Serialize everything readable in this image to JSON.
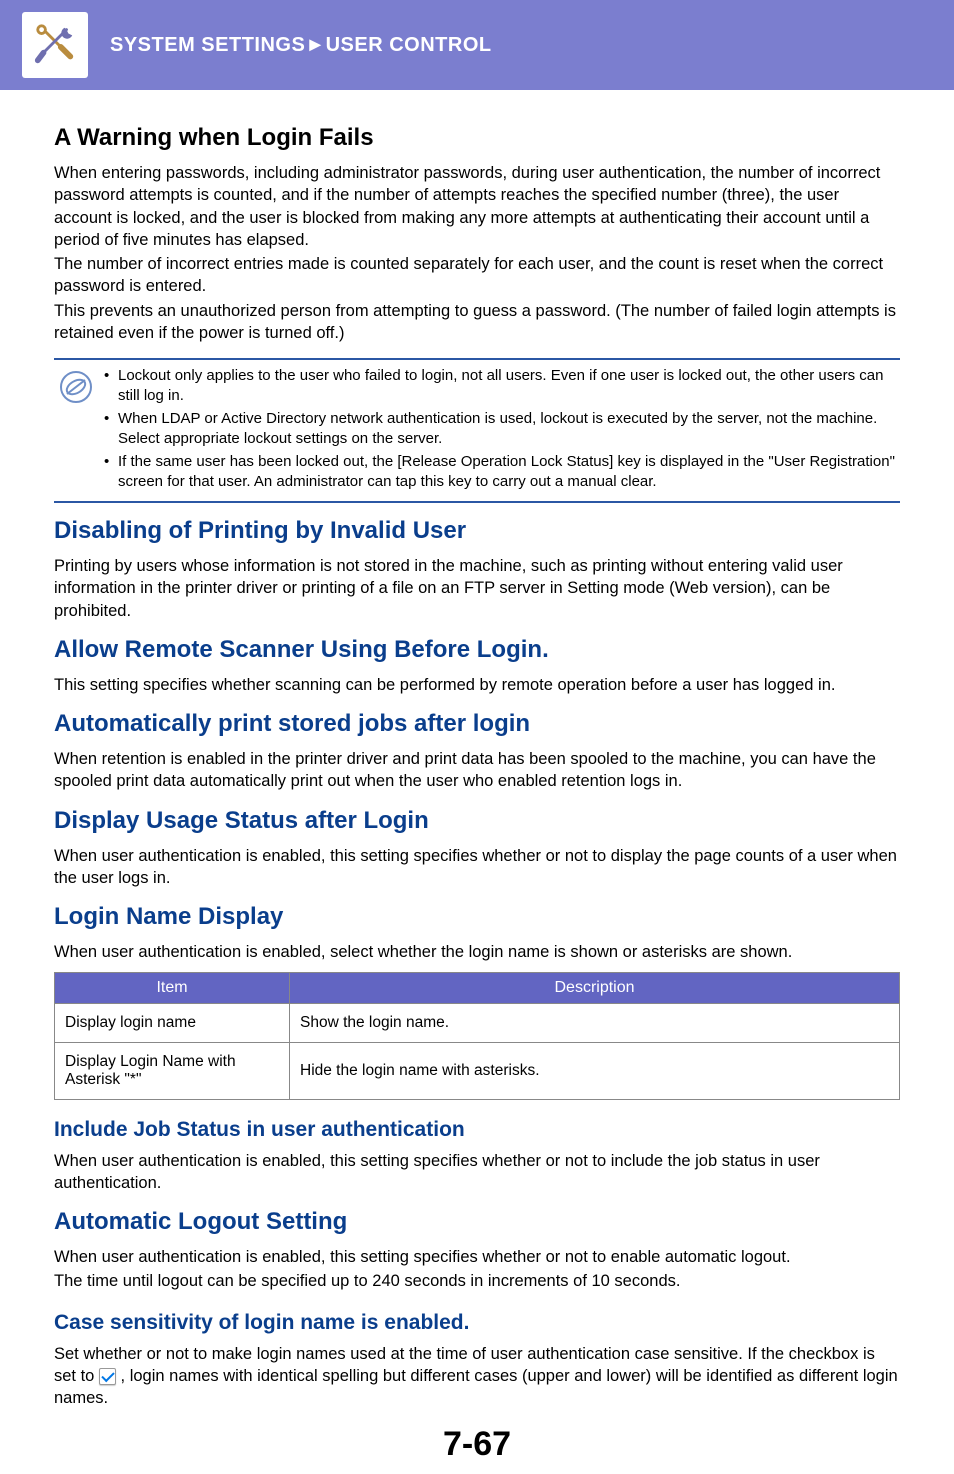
{
  "header": {
    "breadcrumb_left": "SYSTEM SETTINGS",
    "breadcrumb_sep": "►",
    "breadcrumb_right": "USER CONTROL"
  },
  "s1": {
    "title": "A Warning when Login Fails",
    "p1": "When entering passwords, including administrator passwords, during user authentication, the number of incorrect password attempts is counted, and if the number of attempts reaches the specified number (three), the user account is locked, and the user is blocked from making any more attempts at authenticating their account until a period of five minutes has elapsed.",
    "p2": "The number of incorrect entries made is counted separately for each user, and the count is reset when the correct password is entered.",
    "p3": "This prevents an unauthorized person from attempting to guess a password. (The number of failed login attempts is retained even if the power is turned off.)",
    "notes": [
      "Lockout only applies to the user who failed to login, not all users. Even if one user is locked out, the other users can still log in.",
      "When LDAP or Active Directory network authentication is used, lockout is executed by the server, not the machine. Select appropriate lockout settings on the server.",
      "If the same user has been locked out, the [Release Operation Lock Status] key is displayed in the \"User Registration\" screen for that user. An administrator can tap this key to carry out a manual clear."
    ]
  },
  "s2": {
    "title": "Disabling of Printing by Invalid User",
    "p1": "Printing by users whose information is not stored in the machine, such as printing without entering valid user information in the printer driver or printing of a file on an FTP server in Setting mode (Web version), can be prohibited."
  },
  "s3": {
    "title": "Allow Remote Scanner Using Before Login.",
    "p1": "This setting specifies whether scanning can be performed by remote operation before a user has logged in."
  },
  "s4": {
    "title": "Automatically print stored jobs after login",
    "p1": "When retention is enabled in the printer driver and print data has been spooled to the machine, you can have the spooled print data automatically print out when the user who enabled retention logs in."
  },
  "s5": {
    "title": "Display Usage Status after Login",
    "p1": "When user authentication is enabled, this setting specifies whether or not to display the page counts of a user when the user logs in."
  },
  "s6": {
    "title": "Login Name Display",
    "p1": "When user authentication is enabled, select whether the login name is shown or asterisks are shown.",
    "table": {
      "head": [
        "Item",
        "Description"
      ],
      "rows": [
        [
          "Display login name",
          "Show the login name."
        ],
        [
          "Display Login Name with Asterisk \"*\"",
          "Hide the login name with asterisks."
        ]
      ]
    }
  },
  "s7": {
    "title": "Include Job Status in user authentication",
    "p1": "When user authentication is enabled, this setting specifies whether or not to include the job status in user authentication."
  },
  "s8": {
    "title": "Automatic Logout Setting",
    "p1": "When user authentication is enabled, this setting specifies whether or not to enable automatic logout.",
    "p2": "The time until logout can be specified up to 240 seconds in increments of 10 seconds."
  },
  "s9": {
    "title": "Case sensitivity of login name is enabled.",
    "p_before": "Set whether or not to make login names used at the time of user authentication case sensitive. If the checkbox is set to ",
    "p_after": " , login names with identical spelling but different cases (upper and lower) will be identified as different login names."
  },
  "page_number": "7-67"
}
